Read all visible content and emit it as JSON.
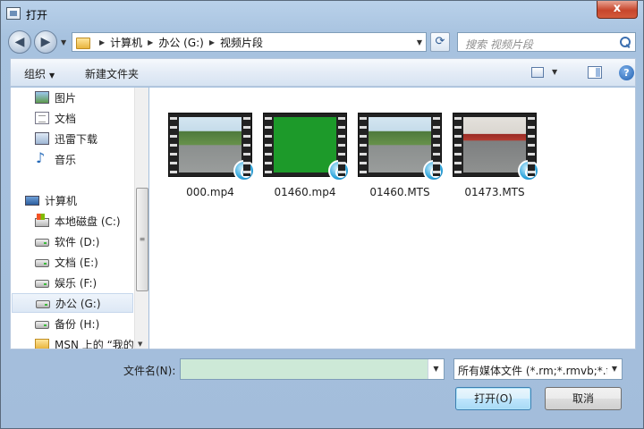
{
  "window": {
    "title": "打开",
    "close_label": "x"
  },
  "nav": {
    "back_glyph": "◀",
    "forward_glyph": "▶",
    "breadcrumbs": [
      "计算机",
      "办公 (G:)",
      "视频片段"
    ],
    "search_placeholder": "搜索 视频片段"
  },
  "toolbar": {
    "organize_label": "组织",
    "new_folder_label": "新建文件夹",
    "help_glyph": "?"
  },
  "sidebar": {
    "items": [
      {
        "label": "图片",
        "icon": "pictures-icon"
      },
      {
        "label": "文档",
        "icon": "documents-icon"
      },
      {
        "label": "迅雷下载",
        "icon": "download-icon"
      },
      {
        "label": "音乐",
        "icon": "music-icon"
      },
      {
        "label": "计算机",
        "icon": "computer-icon"
      },
      {
        "label": "本地磁盘 (C:)",
        "icon": "system-drive-icon"
      },
      {
        "label": "软件 (D:)",
        "icon": "drive-icon"
      },
      {
        "label": "文档 (E:)",
        "icon": "drive-icon"
      },
      {
        "label": "娱乐 (F:)",
        "icon": "drive-icon"
      },
      {
        "label": "办公 (G:)",
        "icon": "drive-icon",
        "selected": true
      },
      {
        "label": "备份 (H:)",
        "icon": "drive-icon"
      },
      {
        "label": "MSN 上的 “我的",
        "icon": "folder-icon"
      }
    ]
  },
  "files": [
    {
      "name": "000.mp4",
      "thumb": "road"
    },
    {
      "name": "01460.mp4",
      "thumb": "green"
    },
    {
      "name": "01460.MTS",
      "thumb": "road"
    },
    {
      "name": "01473.MTS",
      "thumb": "station"
    }
  ],
  "footer": {
    "filename_label": "文件名(N):",
    "filename_value": "",
    "filetype_value": "所有媒体文件 (*.rm;*.rmvb;*.fl",
    "open_label": "打开(O)",
    "cancel_label": "取消"
  }
}
